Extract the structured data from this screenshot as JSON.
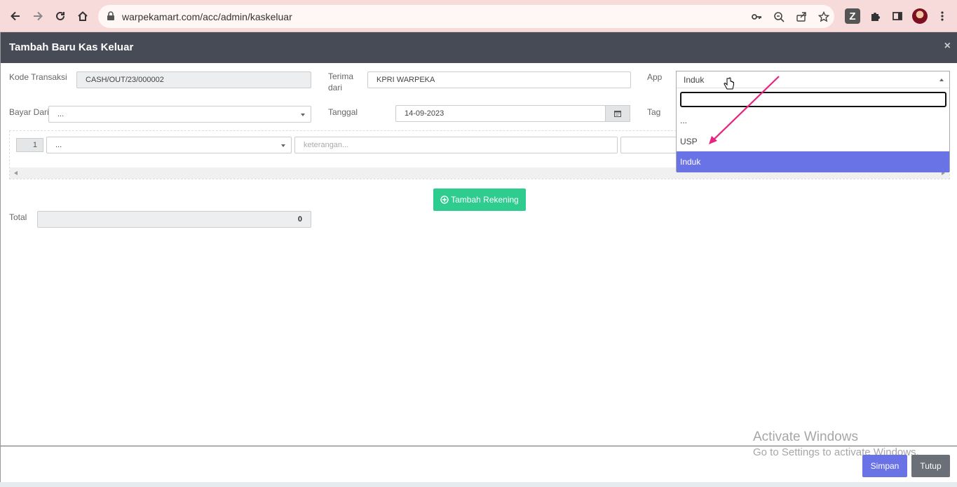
{
  "browser": {
    "url": "warpekamart.com/acc/admin/kaskeluar",
    "icons": [
      "back-icon",
      "forward-icon",
      "reload-icon",
      "home-icon",
      "lock-icon",
      "key-icon",
      "zoom-icon",
      "share-icon",
      "star-icon",
      "z-extension-icon",
      "puzzle-icon",
      "sidepanel-icon",
      "avatar",
      "menu-icon"
    ]
  },
  "modal": {
    "title": "Tambah Baru Kas Keluar",
    "close": "×"
  },
  "form": {
    "kode_label": "Kode Transaksi",
    "kode_value": "CASH/OUT/23/000002",
    "terima_label_1": "Terima",
    "terima_label_2": "dari",
    "terima_value": "KPRI WARPEKA",
    "app_label": "App",
    "bayar_label": "Bayar Dari",
    "bayar_value": "...",
    "tanggal_label": "Tanggal",
    "tanggal_value": "14-09-2023",
    "tag_label": "Tag"
  },
  "row": {
    "number": "1",
    "account_value": "...",
    "keterangan_placeholder": "keterangan..."
  },
  "add_button": "Tambah Rekening",
  "total": {
    "label": "Total",
    "value": "0"
  },
  "dropdown": {
    "selected": "Induk",
    "options": [
      "...",
      "USP",
      "Induk"
    ],
    "highlighted": "Induk"
  },
  "footer": {
    "save": "Simpan",
    "close": "Tutup"
  },
  "watermark": {
    "line1": "Activate Windows",
    "line2": "Go to Settings to activate Windows."
  },
  "colors": {
    "header": "#474b55",
    "primary": "#6a73e6",
    "success": "#2ecc8f",
    "annotation": "#e8247f"
  }
}
